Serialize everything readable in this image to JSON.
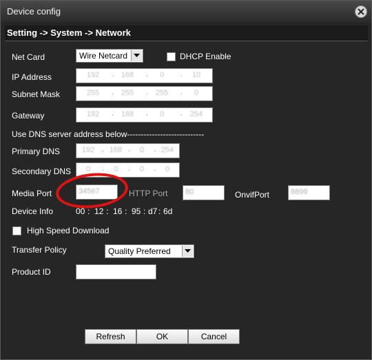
{
  "window": {
    "title": "Device config"
  },
  "breadcrumb": "Setting -> System -> Network",
  "net_card": {
    "label": "Net Card",
    "value": "Wire Netcard"
  },
  "dhcp": {
    "label": "DHCP Enable",
    "checked": false
  },
  "ip_address": {
    "label": "IP Address",
    "octets": [
      "192",
      "168",
      "0",
      "10"
    ]
  },
  "subnet_mask": {
    "label": "Subnet Mask",
    "octets": [
      "255",
      "255",
      "255",
      "0"
    ]
  },
  "gateway": {
    "label": "Gateway",
    "octets": [
      "192",
      "168",
      "0",
      "254"
    ]
  },
  "dns_note": "Use DNS server address below----------------------------",
  "primary_dns": {
    "label": "Primary DNS",
    "octets": [
      "192",
      "168",
      "0",
      "254"
    ]
  },
  "secondary_dns": {
    "label": "Secondary DNS",
    "octets": [
      "0",
      "0",
      "0",
      "0"
    ]
  },
  "media_port": {
    "label": "Media Port",
    "value": "34567"
  },
  "http_port": {
    "label": "HTTP Port",
    "value": "80"
  },
  "onvif_port": {
    "label": "OnvifPort",
    "value": "8899"
  },
  "device_info": {
    "label": "Device Info",
    "mac": [
      "00",
      "12",
      "16",
      "95",
      "d7",
      "6d"
    ],
    "sep": ":"
  },
  "high_speed": {
    "label": "High Speed Download",
    "checked": false
  },
  "transfer_policy": {
    "label": "Transfer Policy",
    "value": "Quality Preferred"
  },
  "product_id": {
    "label": "Product ID",
    "value": ""
  },
  "buttons": {
    "refresh": "Refresh",
    "ok": "OK",
    "cancel": "Cancel"
  },
  "colors": {
    "annotation": "#e01212",
    "background": "#262626"
  }
}
